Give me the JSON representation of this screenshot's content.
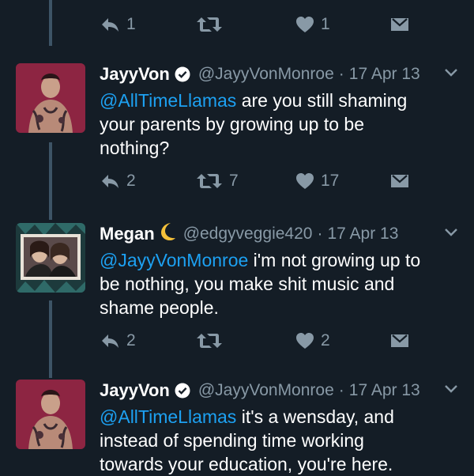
{
  "top_actions": {
    "reply_count": "1",
    "retweet_count": "",
    "like_count": "1"
  },
  "tweets": [
    {
      "name": "JayyVon",
      "handle": "@JayyVonMonroe",
      "date": "17 Apr 13",
      "mention": "@AllTimeLlamas",
      "text_lines": [
        " are you still shaming",
        "your parents by growing up to be",
        "nothing?"
      ],
      "reply_count": "2",
      "retweet_count": "7",
      "like_count": "17"
    },
    {
      "name": "Megan",
      "handle": "@edgyveggie420",
      "date": "17 Apr 13",
      "mention": "@JayyVonMonroe",
      "text_lines": [
        " i'm not growing up to",
        "be nothing, you make shit music and",
        "shame people."
      ],
      "reply_count": "2",
      "retweet_count": "",
      "like_count": "2"
    },
    {
      "name": "JayyVon",
      "handle": "@JayyVonMonroe",
      "date": "17 Apr 13",
      "mention": "@AllTimeLlamas",
      "text_lines": [
        " it's a wensday, and",
        "instead of spending time working",
        "towards your education, you're here."
      ]
    }
  ],
  "separator": "·",
  "icons": {
    "reply": "reply-icon",
    "retweet": "retweet-icon",
    "like": "heart-icon",
    "dm": "direct-message-icon",
    "more": "chevron-down-icon",
    "verified": "verified-badge-icon",
    "moon": "crescent-moon-icon"
  },
  "colors": {
    "background": "#141d26",
    "text": "#ffffff",
    "secondary": "#8899a6",
    "link": "#1da1f2",
    "thread_line": "#3d5466"
  }
}
